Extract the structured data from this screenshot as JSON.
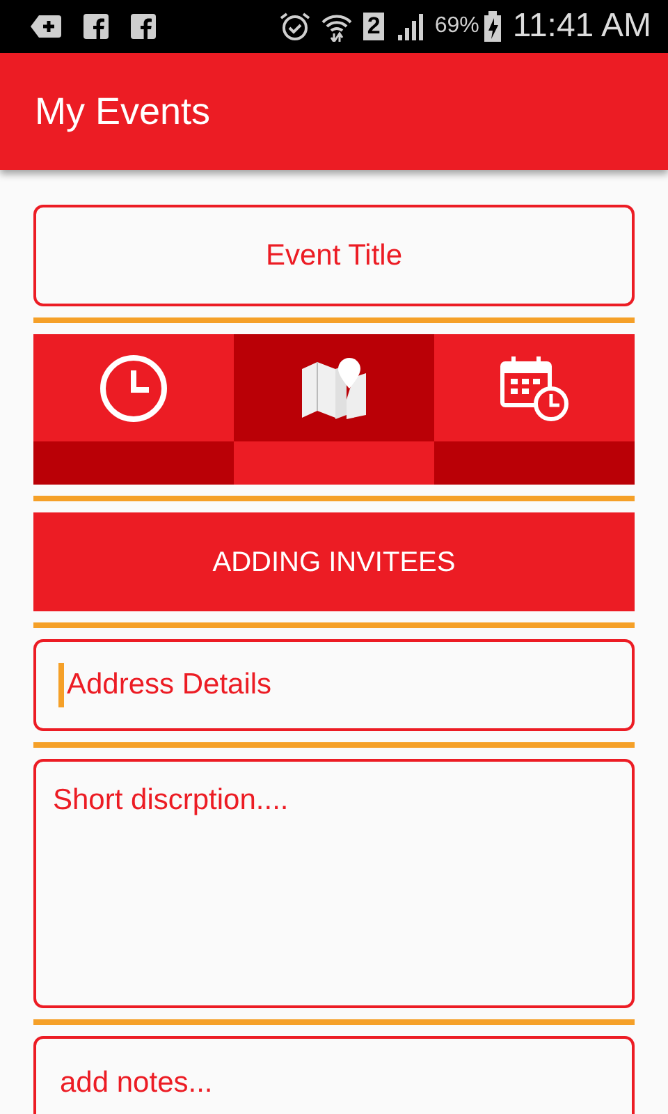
{
  "status_bar": {
    "sim": "2",
    "battery": "69%",
    "time": "11:41 AM"
  },
  "app_bar": {
    "title": "My Events"
  },
  "title_field": {
    "placeholder": "Event Title",
    "focused": false
  },
  "tabs": [
    {
      "kind": "clock",
      "selected": false
    },
    {
      "kind": "map",
      "selected": true
    },
    {
      "kind": "calendar",
      "selected": false
    }
  ],
  "invitees_button": {
    "label": "ADDING INVITEES"
  },
  "address_field": {
    "placeholder": "Address Details",
    "focused": true
  },
  "description_field": {
    "placeholder": "Short discrption....",
    "focused": false
  },
  "notes_field": {
    "placeholder": "add notes...",
    "focused": false
  }
}
